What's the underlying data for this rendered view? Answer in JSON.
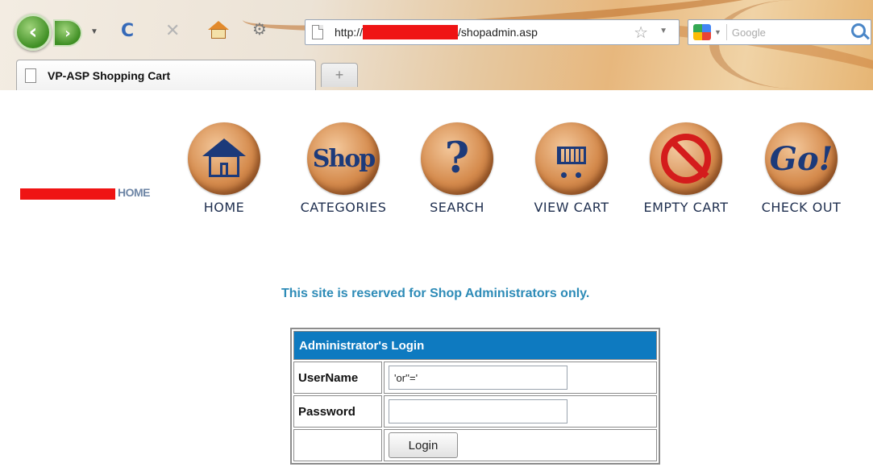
{
  "browser": {
    "url_prefix": "http://",
    "url_suffix": "/shopadmin.asp",
    "search_placeholder": "Google",
    "tab_title": "VP-ASP Shopping Cart",
    "new_tab_symbol": "+",
    "icons": {
      "back": "back-arrow-icon",
      "forward": "forward-arrow-icon",
      "reload": "reload-icon",
      "stop": "stop-icon",
      "home": "home-icon",
      "addon": "addon-icon",
      "bookmark": "star-icon",
      "search_engine": "google-icon",
      "search": "magnifier-icon"
    }
  },
  "page": {
    "brand_home": "HOME",
    "nav": [
      {
        "label": "HOME",
        "icon": "house-icon"
      },
      {
        "label": "CATEGORIES",
        "icon": "shop-icon"
      },
      {
        "label": "SEARCH",
        "icon": "question-mark-icon"
      },
      {
        "label": "VIEW CART",
        "icon": "shopping-cart-icon"
      },
      {
        "label": "EMPTY CART",
        "icon": "no-entry-icon"
      },
      {
        "label": "CHECK OUT",
        "icon": "go-icon"
      }
    ],
    "notice": "This site is reserved for Shop Administrators only.",
    "login": {
      "header": "Administrator's Login",
      "username_label": "UserName",
      "username_value": "'or''='",
      "password_label": "Password",
      "password_value": "",
      "button": "Login"
    },
    "colors": {
      "header_bg": "#0e7ac0",
      "notice_text": "#2d8bb7",
      "redaction": "#ef1414"
    }
  }
}
